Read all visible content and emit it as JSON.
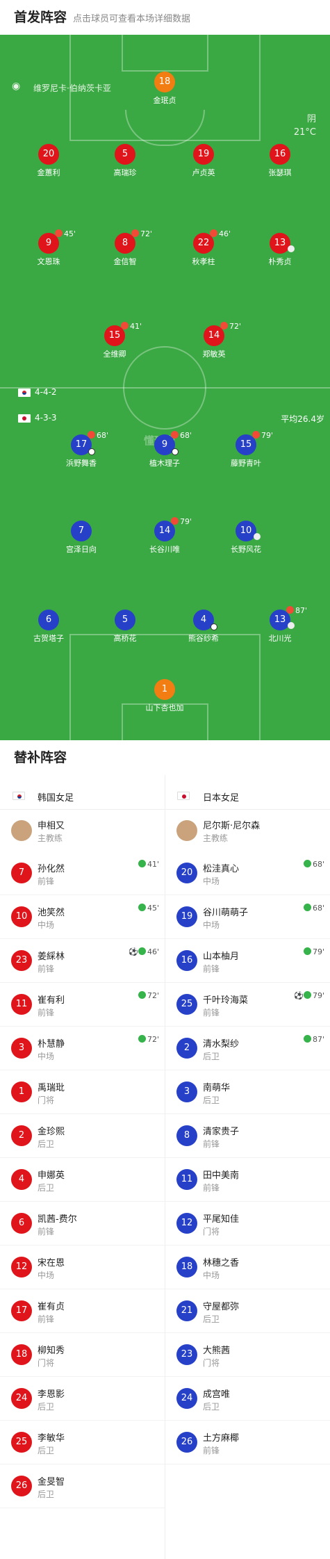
{
  "header": {
    "title": "首发阵容",
    "subtitle": "点击球员可查看本场详细数据"
  },
  "pitch": {
    "stadium": "维罗尼卡·伯纳茨卡亚",
    "weather": "阴",
    "temperature": "21°C",
    "home_formation": "4-4-2",
    "away_formation": "4-3-3",
    "away_avg_age": "平均26.4岁",
    "watermark": "懂球帝",
    "home": [
      {
        "n": "18",
        "name": "金珉贞",
        "color": "org"
      },
      {
        "n": "20",
        "name": "金蕙利",
        "color": "red"
      },
      {
        "n": "5",
        "name": "高瑞珍",
        "color": "red"
      },
      {
        "n": "19",
        "name": "卢贞英",
        "color": "red"
      },
      {
        "n": "16",
        "name": "张瑟琪",
        "color": "red"
      },
      {
        "n": "9",
        "name": "文恩珠",
        "color": "red",
        "sub": "45'"
      },
      {
        "n": "8",
        "name": "金信智",
        "color": "red",
        "sub": "72'"
      },
      {
        "n": "22",
        "name": "秋孝柱",
        "color": "red",
        "sub": "46'"
      },
      {
        "n": "13",
        "name": "朴秀贞",
        "color": "red",
        "cap": true
      },
      {
        "n": "15",
        "name": "全维卿",
        "color": "red",
        "sub": "41'"
      },
      {
        "n": "14",
        "name": "郑敏英",
        "color": "red",
        "sub": "72'"
      }
    ],
    "away": [
      {
        "n": "17",
        "name": "浜野舞香",
        "color": "blue",
        "sub": "68'",
        "ball": true
      },
      {
        "n": "9",
        "name": "植木理子",
        "color": "blue",
        "sub": "68'",
        "ball": true
      },
      {
        "n": "15",
        "name": "藤野青叶",
        "color": "blue",
        "sub": "79'"
      },
      {
        "n": "7",
        "name": "宫泽日向",
        "color": "blue"
      },
      {
        "n": "14",
        "name": "长谷川唯",
        "color": "blue",
        "sub": "79'"
      },
      {
        "n": "10",
        "name": "长野风花",
        "color": "blue",
        "cap": true
      },
      {
        "n": "6",
        "name": "古贺塔子",
        "color": "blue"
      },
      {
        "n": "5",
        "name": "高桥花",
        "color": "blue"
      },
      {
        "n": "4",
        "name": "熊谷纱希",
        "color": "blue",
        "ball": true
      },
      {
        "n": "13",
        "name": "北川光",
        "color": "blue",
        "sub": "87'",
        "cap": true
      },
      {
        "n": "1",
        "name": "山下杏也加",
        "color": "org"
      }
    ]
  },
  "subs": {
    "title": "替补阵容",
    "home_team": "韩国女足",
    "away_team": "日本女足",
    "home_coach": {
      "name": "申相又",
      "role": "主教练"
    },
    "away_coach": {
      "name": "尼尔斯·尼尔森",
      "role": "主教练"
    },
    "home": [
      {
        "n": "7",
        "name": "孙化然",
        "pos": "前锋",
        "ev": "41'"
      },
      {
        "n": "10",
        "name": "池笑然",
        "pos": "中场",
        "ev": "45'"
      },
      {
        "n": "23",
        "name": "姜綵林",
        "pos": "前锋",
        "ev": "46'",
        "goal": true
      },
      {
        "n": "11",
        "name": "崔有利",
        "pos": "前锋",
        "ev": "72'"
      },
      {
        "n": "3",
        "name": "朴慧静",
        "pos": "中场",
        "ev": "72'"
      },
      {
        "n": "1",
        "name": "禹瑞玭",
        "pos": "门将"
      },
      {
        "n": "2",
        "name": "金珍熙",
        "pos": "后卫"
      },
      {
        "n": "4",
        "name": "申娜英",
        "pos": "后卫"
      },
      {
        "n": "6",
        "name": "凯茜-费尔",
        "pos": "前锋"
      },
      {
        "n": "12",
        "name": "宋在恩",
        "pos": "中场"
      },
      {
        "n": "17",
        "name": "崔有贞",
        "pos": "前锋"
      },
      {
        "n": "18",
        "name": "柳知秀",
        "pos": "门将"
      },
      {
        "n": "24",
        "name": "李恩影",
        "pos": "后卫"
      },
      {
        "n": "25",
        "name": "李敏华",
        "pos": "后卫"
      },
      {
        "n": "26",
        "name": "金旻智",
        "pos": "后卫"
      }
    ],
    "away": [
      {
        "n": "20",
        "name": "松洼真心",
        "pos": "中场",
        "ev": "68'"
      },
      {
        "n": "19",
        "name": "谷川萌萌子",
        "pos": "中场",
        "ev": "68'"
      },
      {
        "n": "16",
        "name": "山本柚月",
        "pos": "前锋",
        "ev": "79'"
      },
      {
        "n": "25",
        "name": "千叶玲海菜",
        "pos": "前锋",
        "ev": "79'",
        "goal": true
      },
      {
        "n": "2",
        "name": "清水梨纱",
        "pos": "后卫",
        "ev": "87'"
      },
      {
        "n": "3",
        "name": "南萌华",
        "pos": "后卫"
      },
      {
        "n": "8",
        "name": "清家贵子",
        "pos": "前锋"
      },
      {
        "n": "11",
        "name": "田中美南",
        "pos": "前锋"
      },
      {
        "n": "12",
        "name": "平尾知佳",
        "pos": "门将"
      },
      {
        "n": "18",
        "name": "林穗之香",
        "pos": "中场"
      },
      {
        "n": "21",
        "name": "守屋都弥",
        "pos": "后卫"
      },
      {
        "n": "23",
        "name": "大熊茜",
        "pos": "门将"
      },
      {
        "n": "24",
        "name": "成宫唯",
        "pos": "后卫"
      },
      {
        "n": "26",
        "name": "土方麻椰",
        "pos": "前锋"
      }
    ]
  },
  "colors": {
    "pitch": "#3aa843",
    "home": "#e0151b",
    "away": "#2641c8",
    "keeper": "#f27d12"
  }
}
